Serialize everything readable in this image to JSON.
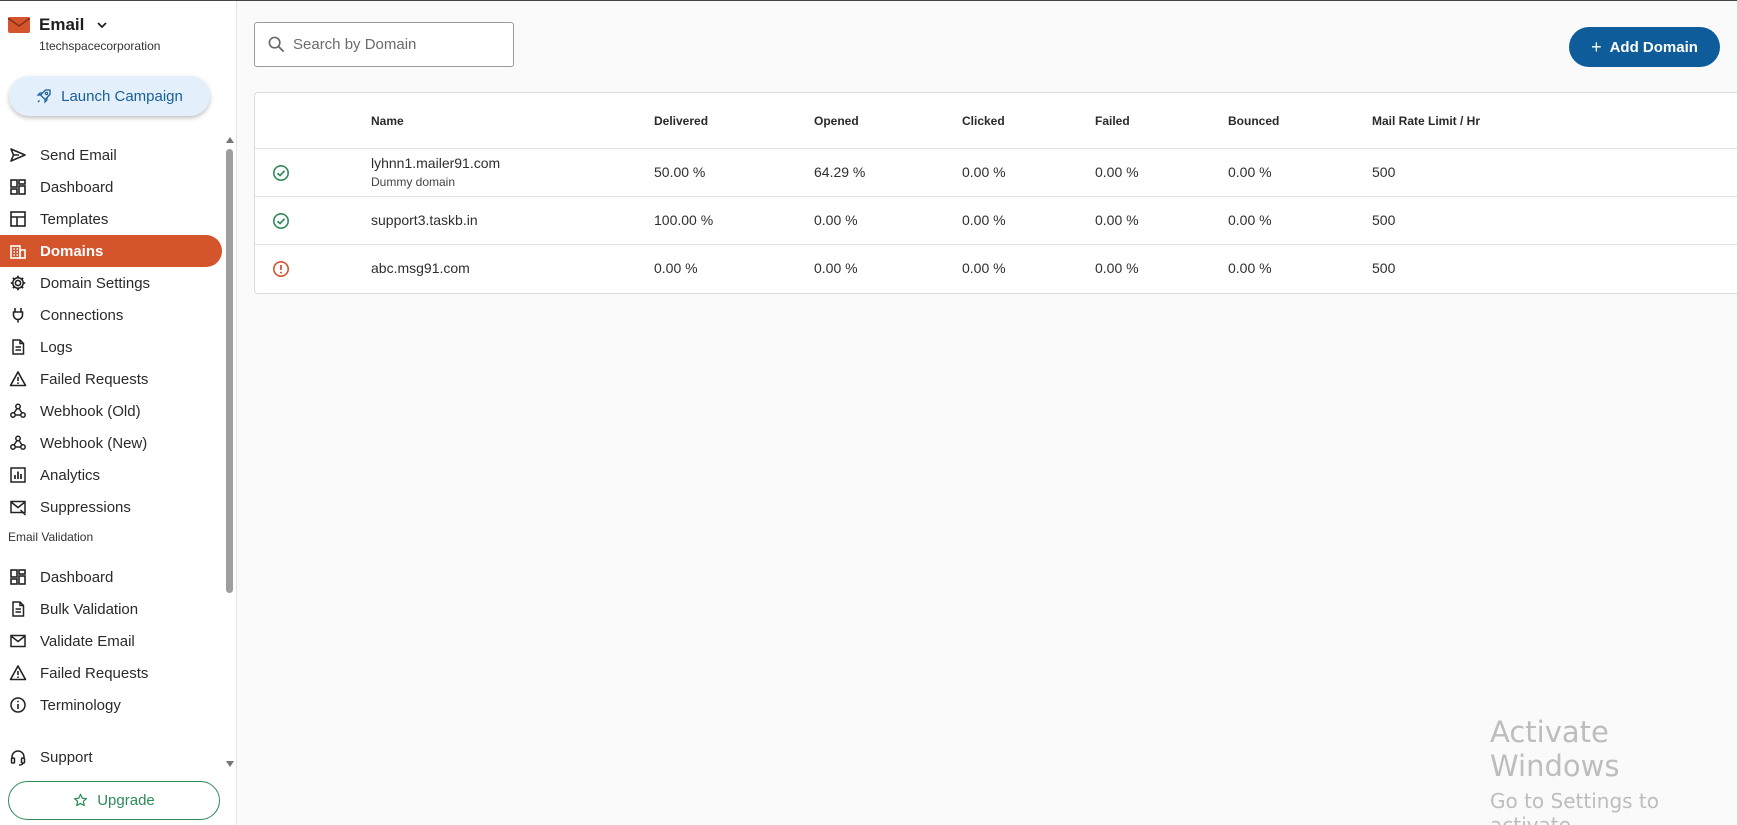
{
  "sidebar": {
    "app_title": "Email",
    "org_name": "1techspacecorporation",
    "launch_label": "Launch Campaign",
    "items": [
      {
        "label": "Send Email",
        "icon": "send-icon"
      },
      {
        "label": "Dashboard",
        "icon": "dashboard-icon"
      },
      {
        "label": "Templates",
        "icon": "templates-icon"
      },
      {
        "label": "Domains",
        "icon": "domains-icon",
        "active": true
      },
      {
        "label": "Domain Settings",
        "icon": "gear-icon"
      },
      {
        "label": "Connections",
        "icon": "plug-icon"
      },
      {
        "label": "Logs",
        "icon": "document-icon"
      },
      {
        "label": "Failed Requests",
        "icon": "warning-icon"
      },
      {
        "label": "Webhook (Old)",
        "icon": "webhook-icon"
      },
      {
        "label": "Webhook (New)",
        "icon": "webhook-icon"
      },
      {
        "label": "Analytics",
        "icon": "analytics-icon"
      },
      {
        "label": "Suppressions",
        "icon": "suppressions-icon"
      }
    ],
    "section_label": "Email Validation",
    "validation_items": [
      {
        "label": "Dashboard",
        "icon": "dashboard-icon"
      },
      {
        "label": "Bulk Validation",
        "icon": "document-icon"
      },
      {
        "label": "Validate Email",
        "icon": "mail-icon"
      },
      {
        "label": "Failed Requests",
        "icon": "warning-icon"
      },
      {
        "label": "Terminology",
        "icon": "info-icon"
      }
    ],
    "support_label": "Support",
    "upgrade_label": "Upgrade"
  },
  "search": {
    "placeholder": "Search by Domain"
  },
  "add_domain_label": "Add Domain",
  "table": {
    "headers": [
      "Name",
      "Delivered",
      "Opened",
      "Clicked",
      "Failed",
      "Bounced",
      "Mail Rate Limit / Hr"
    ],
    "rows": [
      {
        "status": "verified",
        "name": "lyhnn1.mailer91.com",
        "sub": "Dummy domain",
        "delivered": "50.00 %",
        "opened": "64.29 %",
        "clicked": "0.00 %",
        "failed": "0.00 %",
        "bounced": "0.00 %",
        "rate": "500"
      },
      {
        "status": "verified",
        "name": "support3.taskb.in",
        "sub": "",
        "delivered": "100.00 %",
        "opened": "0.00 %",
        "clicked": "0.00 %",
        "failed": "0.00 %",
        "bounced": "0.00 %",
        "rate": "500"
      },
      {
        "status": "unverified",
        "name": "abc.msg91.com",
        "sub": "",
        "delivered": "0.00 %",
        "opened": "0.00 %",
        "clicked": "0.00 %",
        "failed": "0.00 %",
        "bounced": "0.00 %",
        "rate": "500"
      }
    ]
  },
  "colors": {
    "accent": "#d4552c",
    "primary": "#0f5c9b",
    "success": "#2e8b57",
    "error": "#d4552c"
  },
  "watermark": {
    "line1": "Activate Windows",
    "line2": "Go to Settings to activate"
  }
}
